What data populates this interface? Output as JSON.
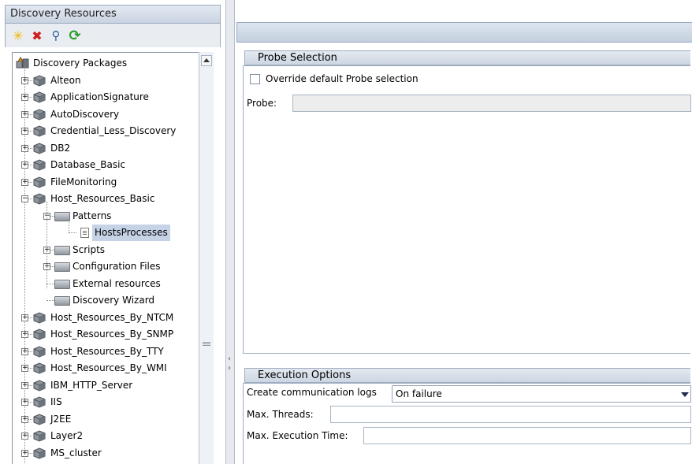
{
  "left_panel": {
    "title": "Discovery Resources",
    "toolbar": [
      {
        "name": "new-icon",
        "glyph": "✳",
        "color": "#f2b600"
      },
      {
        "name": "delete-icon",
        "glyph": "✖",
        "color": "#d11a1a"
      },
      {
        "name": "search-icon",
        "glyph": "⚲",
        "color": "#2f5d9a"
      },
      {
        "name": "refresh-icon",
        "glyph": "⟳",
        "color": "#2e9b2e"
      }
    ],
    "tree": {
      "root": "Discovery Packages",
      "items": [
        {
          "label": "Alteon",
          "type": "package",
          "level": 1,
          "expander": "+"
        },
        {
          "label": "ApplicationSignature",
          "type": "package",
          "level": 1,
          "expander": "+"
        },
        {
          "label": "AutoDiscovery",
          "type": "package",
          "level": 1,
          "expander": "+"
        },
        {
          "label": "Credential_Less_Discovery",
          "type": "package",
          "level": 1,
          "expander": "+"
        },
        {
          "label": "DB2",
          "type": "package",
          "level": 1,
          "expander": "+"
        },
        {
          "label": "Database_Basic",
          "type": "package",
          "level": 1,
          "expander": "+"
        },
        {
          "label": "FileMonitoring",
          "type": "package",
          "level": 1,
          "expander": "+"
        },
        {
          "label": "Host_Resources_Basic",
          "type": "package",
          "level": 1,
          "expander": "−"
        },
        {
          "label": "Patterns",
          "type": "folder",
          "level": 2,
          "expander": "−"
        },
        {
          "label": "HostsProcesses",
          "type": "file",
          "level": 3,
          "expander": "",
          "selected": true
        },
        {
          "label": "Scripts",
          "type": "folder",
          "level": 2,
          "expander": "+"
        },
        {
          "label": "Configuration Files",
          "type": "folder",
          "level": 2,
          "expander": "+"
        },
        {
          "label": "External resources",
          "type": "folder",
          "level": 2,
          "expander": ""
        },
        {
          "label": "Discovery Wizard",
          "type": "folder",
          "level": 2,
          "expander": ""
        },
        {
          "label": "Host_Resources_By_NTCM",
          "type": "package",
          "level": 1,
          "expander": "+"
        },
        {
          "label": "Host_Resources_By_SNMP",
          "type": "package",
          "level": 1,
          "expander": "+"
        },
        {
          "label": "Host_Resources_By_TTY",
          "type": "package",
          "level": 1,
          "expander": "+"
        },
        {
          "label": "Host_Resources_By_WMI",
          "type": "package",
          "level": 1,
          "expander": "+"
        },
        {
          "label": "IBM_HTTP_Server",
          "type": "package",
          "level": 1,
          "expander": "+"
        },
        {
          "label": "IIS",
          "type": "package",
          "level": 1,
          "expander": "+"
        },
        {
          "label": "J2EE",
          "type": "package",
          "level": 1,
          "expander": "+"
        },
        {
          "label": "Layer2",
          "type": "package",
          "level": 1,
          "expander": "+"
        },
        {
          "label": "MS_cluster",
          "type": "package",
          "level": 1,
          "expander": "+"
        }
      ]
    }
  },
  "probe_selection": {
    "title": "Probe Selection",
    "override_label": "Override default Probe selection",
    "override_checked": false,
    "probe_label": "Probe:",
    "probe_value": ""
  },
  "execution_options": {
    "title": "Execution Options",
    "comm_logs_label": "Create communication logs",
    "comm_logs_value": "On failure",
    "max_threads_label": "Max. Threads:",
    "max_threads_value": "",
    "max_exec_time_label": "Max. Execution Time:",
    "max_exec_time_value": ""
  }
}
